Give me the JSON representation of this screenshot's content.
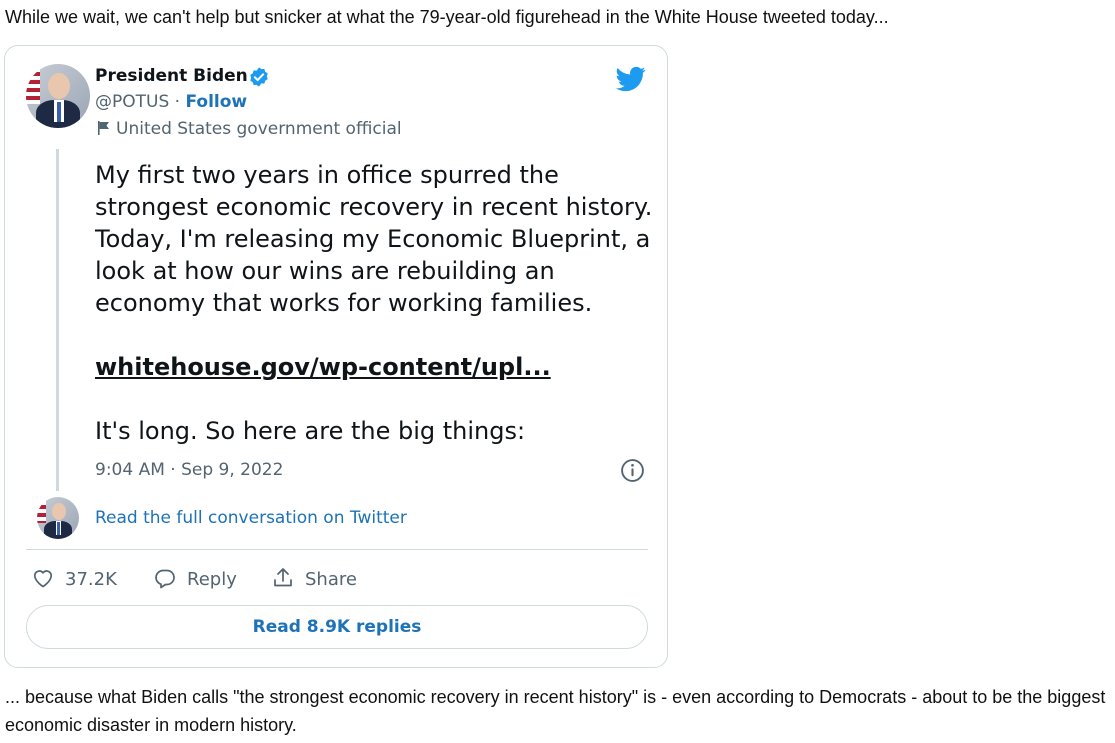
{
  "article": {
    "intro": "While we wait, we can't help but snicker at what the 79-year-old figurehead in the White House tweeted today...",
    "outro": "... because what Biden calls \"the strongest economic recovery in recent history\" is - even according to Democrats - about to be the biggest economic disaster in modern history."
  },
  "tweet": {
    "author_name": "President Biden",
    "handle": "@POTUS",
    "separator": " · ",
    "follow_label": "Follow",
    "gov_label": "United States government official",
    "body": "My first two years in office spurred the strongest economic recovery in recent history. Today, I'm releasing my Economic Blueprint, a look at how our wins are rebuilding an economy that works for working families.",
    "link_text": "whitehouse.gov/wp-content/upl...",
    "tail": "It's long. So here are the big things:",
    "timestamp": "9:04 AM · Sep 9, 2022",
    "read_conversation": "Read the full conversation on Twitter",
    "likes": "37.2K",
    "reply_label": "Reply",
    "share_label": "Share",
    "read_replies": "Read 8.9K replies"
  },
  "colors": {
    "link_blue": "#1d72b8",
    "verified_blue": "#1d9bf0",
    "twitter_blue": "#1d9bf0",
    "muted_gray": "#536471",
    "border": "#cfd9de"
  },
  "icons": [
    "verified-badge-icon",
    "twitter-bird-icon",
    "flag-icon",
    "info-icon",
    "heart-icon",
    "reply-bubble-icon",
    "share-icon"
  ]
}
